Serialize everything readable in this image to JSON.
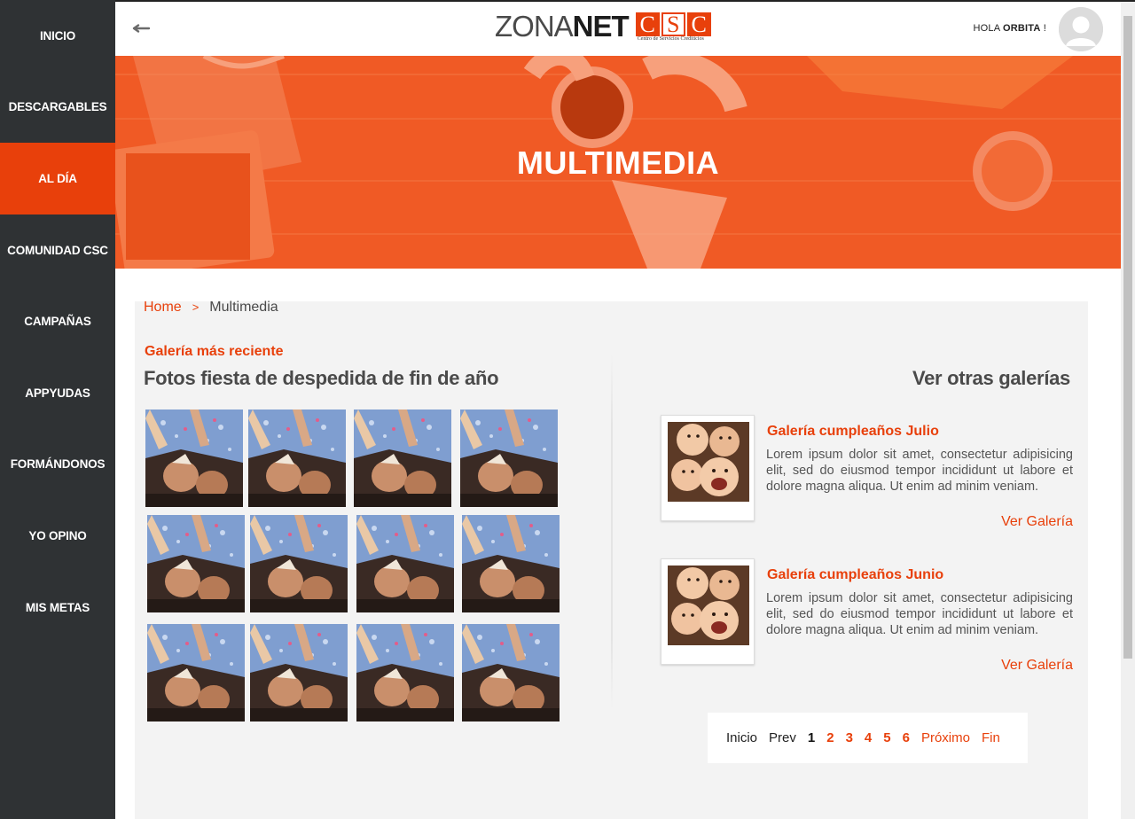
{
  "sidebar": {
    "items": [
      {
        "label": "INICIO"
      },
      {
        "label": "DESCARGABLES"
      },
      {
        "label": "AL DÍA"
      },
      {
        "label": "COMUNIDAD CSC"
      },
      {
        "label": "CAMPAÑAS"
      },
      {
        "label": "APPYUDAS"
      },
      {
        "label": "FORMÁNDONOS"
      },
      {
        "label": "YO OPINO"
      },
      {
        "label": "MIS METAS"
      }
    ],
    "active_index": 2
  },
  "header": {
    "logo_zona": "ZONA",
    "logo_net": "NET",
    "logo_c1": "C",
    "logo_s": "S",
    "logo_c2": "C",
    "logo_sub": "Centro de Servicios Crediticios",
    "greeting_prefix": "HOLA ",
    "greeting_name": "ORBITA",
    "greeting_suffix": " !",
    "back_icon": "arrow-left-icon",
    "avatar_icon": "user-avatar-icon"
  },
  "hero": {
    "title": "MULTIMEDIA"
  },
  "breadcrumb": {
    "home": "Home",
    "separator": ">",
    "current": "Multimedia"
  },
  "recent_gallery": {
    "label": "Galería más reciente",
    "title": "Fotos fiesta de despedida de fin de año",
    "photo_count": 12
  },
  "other_galleries": {
    "title": "Ver otras galerías",
    "cards": [
      {
        "title": "Galería cumpleaños Julio",
        "description": "Lorem ipsum dolor sit amet, consectetur adipisicing elit, sed do eiusmod tempor incididunt ut labore et dolore magna aliqua. Ut enim ad minim veniam.",
        "link": "Ver Galería"
      },
      {
        "title": "Galería cumpleaños Junio",
        "description": "Lorem ipsum dolor sit amet, consectetur adipisicing elit, sed do eiusmod tempor incididunt ut labore et dolore magna aliqua. Ut enim ad minim veniam.",
        "link": "Ver Galería"
      }
    ]
  },
  "pager": {
    "first": "Inicio",
    "prev": "Prev",
    "pages": [
      "1",
      "2",
      "3",
      "4",
      "5",
      "6"
    ],
    "current_page": "1",
    "next": "Próximo",
    "last": "Fin"
  },
  "colors": {
    "accent": "#e8400b",
    "sidebar_bg": "#2f3234",
    "panel_bg": "#f3f3f3"
  }
}
